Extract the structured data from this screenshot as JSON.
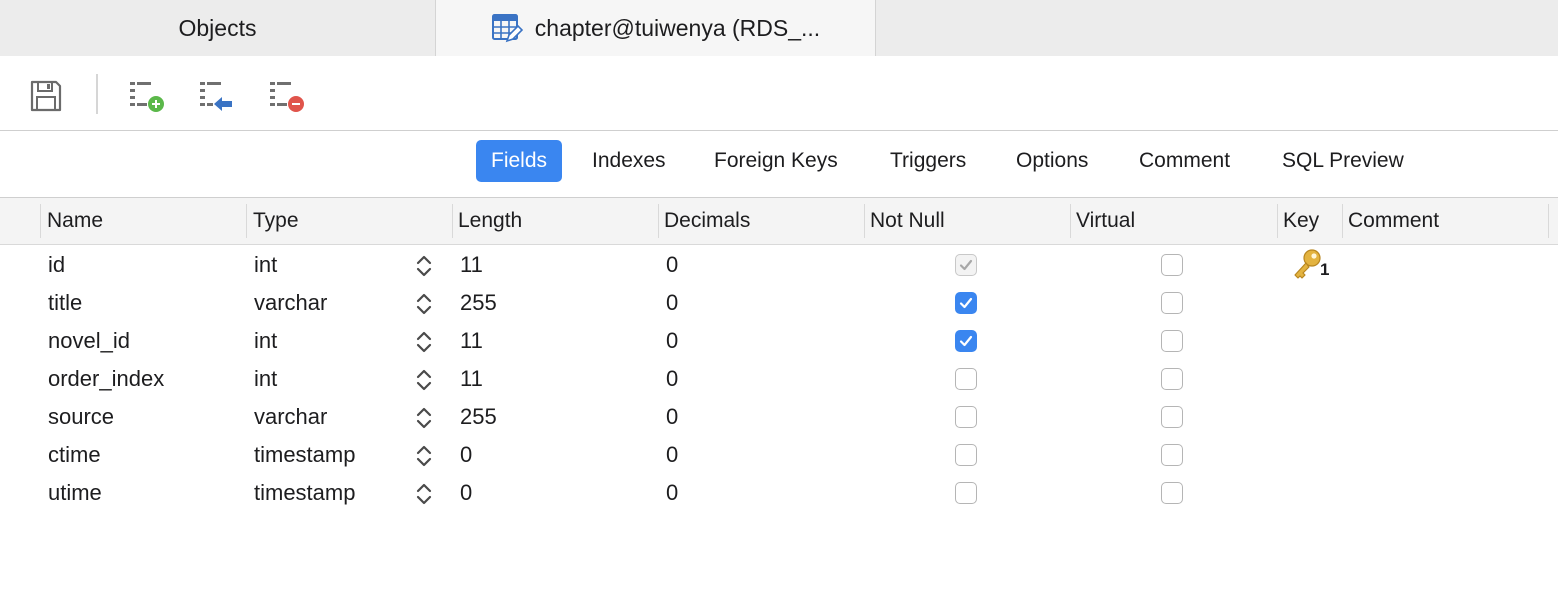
{
  "tabs": {
    "objects_label": "Objects",
    "active_label": "chapter@tuiwenya (RDS_..."
  },
  "toolbar": {
    "save_icon": "save-icon",
    "add_field_icon": "add-field-icon",
    "insert_field_icon": "insert-field-icon",
    "delete_field_icon": "delete-field-icon"
  },
  "segments": [
    {
      "label": "Fields",
      "active": true
    },
    {
      "label": "Indexes",
      "active": false
    },
    {
      "label": "Foreign Keys",
      "active": false
    },
    {
      "label": "Triggers",
      "active": false
    },
    {
      "label": "Options",
      "active": false
    },
    {
      "label": "Comment",
      "active": false
    },
    {
      "label": "SQL Preview",
      "active": false
    }
  ],
  "columns": [
    "Name",
    "Type",
    "Length",
    "Decimals",
    "Not Null",
    "Virtual",
    "Key",
    "Comment"
  ],
  "fields": [
    {
      "name": "id",
      "type": "int",
      "length": "11",
      "decimals": "0",
      "not_null": "disabled-checked",
      "virtual": false,
      "key": "1",
      "comment": ""
    },
    {
      "name": "title",
      "type": "varchar",
      "length": "255",
      "decimals": "0",
      "not_null": "checked",
      "virtual": false,
      "key": "",
      "comment": ""
    },
    {
      "name": "novel_id",
      "type": "int",
      "length": "11",
      "decimals": "0",
      "not_null": "checked",
      "virtual": false,
      "key": "",
      "comment": ""
    },
    {
      "name": "order_index",
      "type": "int",
      "length": "11",
      "decimals": "0",
      "not_null": "unchecked",
      "virtual": false,
      "key": "",
      "comment": ""
    },
    {
      "name": "source",
      "type": "varchar",
      "length": "255",
      "decimals": "0",
      "not_null": "unchecked",
      "virtual": false,
      "key": "",
      "comment": ""
    },
    {
      "name": "ctime",
      "type": "timestamp",
      "length": "0",
      "decimals": "0",
      "not_null": "unchecked",
      "virtual": false,
      "key": "",
      "comment": ""
    },
    {
      "name": "utime",
      "type": "timestamp",
      "length": "0",
      "decimals": "0",
      "not_null": "unchecked",
      "virtual": false,
      "key": "",
      "comment": ""
    }
  ],
  "colors": {
    "accent": "#3a86f0",
    "add": "#5bb84a",
    "delete": "#e0544b",
    "key": "#e3b340"
  }
}
